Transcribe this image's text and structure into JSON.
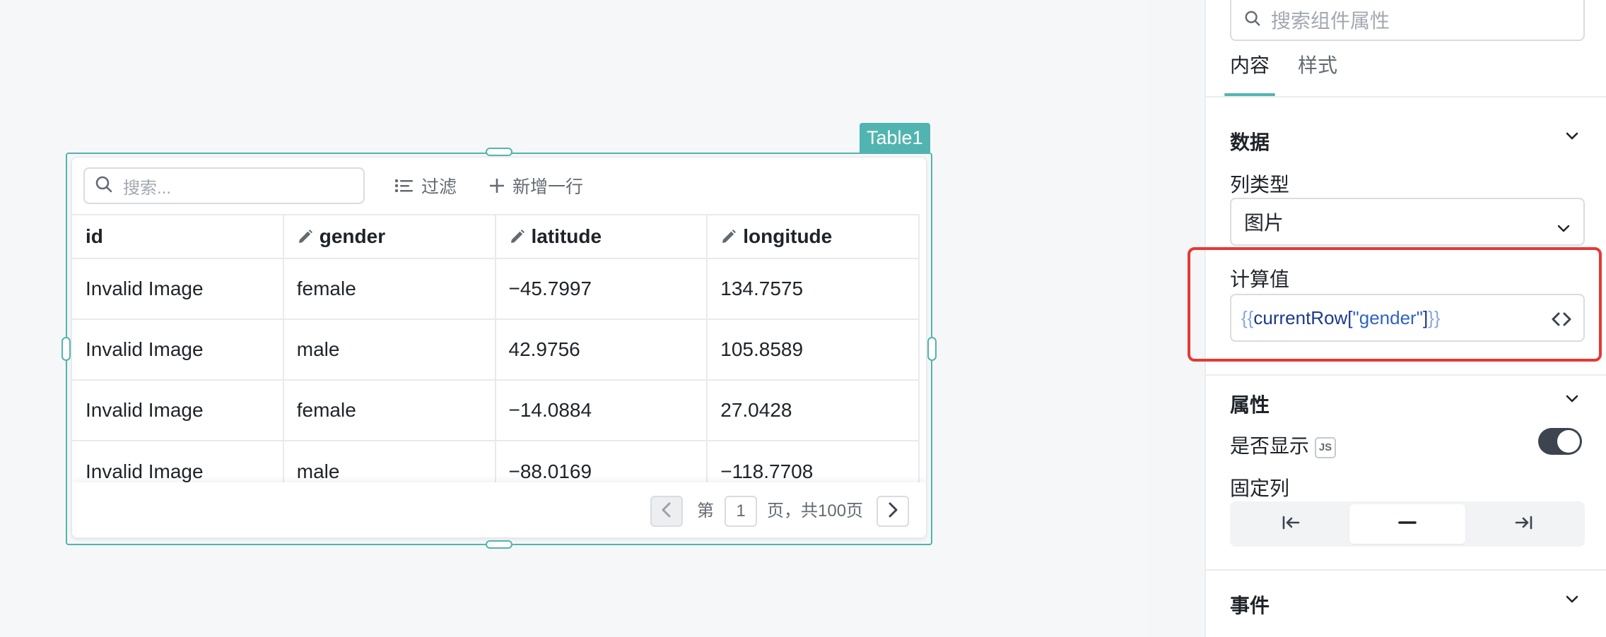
{
  "canvas": {
    "component_tag": "Table1",
    "table": {
      "search_placeholder": "搜索...",
      "filter_label": "过滤",
      "add_row_label": "新增一行",
      "columns": [
        {
          "label": "id",
          "editable": false
        },
        {
          "label": "gender",
          "editable": true
        },
        {
          "label": "latitude",
          "editable": true
        },
        {
          "label": "longitude",
          "editable": true
        }
      ],
      "rows": [
        [
          "Invalid Image",
          "female",
          "−45.7997",
          "134.7575"
        ],
        [
          "Invalid Image",
          "male",
          "42.9756",
          "105.8589"
        ],
        [
          "Invalid Image",
          "female",
          "−14.0884",
          "27.0428"
        ],
        [
          "Invalid Image",
          "male",
          "−88.0169",
          "−118.7708"
        ]
      ],
      "pagination": {
        "prefix": "第",
        "current_page": "1",
        "suffix": "页，共100页"
      }
    }
  },
  "panel": {
    "search_placeholder": "搜索组件属性",
    "tabs": [
      {
        "label": "内容",
        "active": true
      },
      {
        "label": "样式",
        "active": false
      }
    ],
    "data_section": {
      "title": "数据",
      "column_type_label": "列类型",
      "column_type_value": "图片",
      "computed_label": "计算值",
      "computed_value": {
        "open": "{{",
        "ident": "currentRow[",
        "string": "\"gender\"",
        "close_bracket": "]",
        "close": "}}"
      }
    },
    "props_section": {
      "title": "属性",
      "visible_label": "是否显示",
      "js_badge": "JS",
      "visible_on": true,
      "fixed_column_label": "固定列"
    },
    "events_section": {
      "title": "事件"
    }
  },
  "colors": {
    "accent": "#52b4b0",
    "highlight": "#e53935",
    "toggle_on": "#3d4450"
  }
}
